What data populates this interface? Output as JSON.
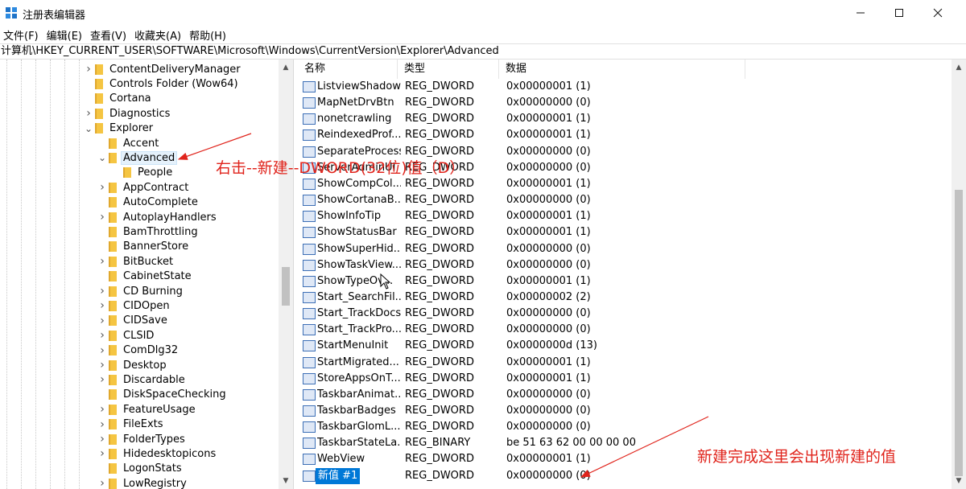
{
  "window": {
    "title": "注册表编辑器",
    "minimize": "—",
    "maximize": "☐",
    "close": "✕"
  },
  "menu": [
    "文件(F)",
    "编辑(E)",
    "查看(V)",
    "收藏夹(A)",
    "帮助(H)"
  ],
  "address": "计算机\\HKEY_CURRENT_USER\\SOFTWARE\\Microsoft\\Windows\\CurrentVersion\\Explorer\\Advanced",
  "tree": [
    {
      "label": "ContentDeliveryManager",
      "level": 1,
      "expander": "collapsed"
    },
    {
      "label": "Controls Folder (Wow64)",
      "level": 1,
      "expander": "none"
    },
    {
      "label": "Cortana",
      "level": 1,
      "expander": "none"
    },
    {
      "label": "Diagnostics",
      "level": 1,
      "expander": "collapsed"
    },
    {
      "label": "Explorer",
      "level": 1,
      "expander": "expanded"
    },
    {
      "label": "Accent",
      "level": 2,
      "expander": "none"
    },
    {
      "label": "Advanced",
      "level": 2,
      "expander": "expanded",
      "selected": true
    },
    {
      "label": "People",
      "level": 3,
      "expander": "none"
    },
    {
      "label": "AppContract",
      "level": 2,
      "expander": "collapsed"
    },
    {
      "label": "AutoComplete",
      "level": 2,
      "expander": "none"
    },
    {
      "label": "AutoplayHandlers",
      "level": 2,
      "expander": "collapsed"
    },
    {
      "label": "BamThrottling",
      "level": 2,
      "expander": "none"
    },
    {
      "label": "BannerStore",
      "level": 2,
      "expander": "none"
    },
    {
      "label": "BitBucket",
      "level": 2,
      "expander": "collapsed"
    },
    {
      "label": "CabinetState",
      "level": 2,
      "expander": "none"
    },
    {
      "label": "CD Burning",
      "level": 2,
      "expander": "collapsed"
    },
    {
      "label": "CIDOpen",
      "level": 2,
      "expander": "collapsed"
    },
    {
      "label": "CIDSave",
      "level": 2,
      "expander": "collapsed"
    },
    {
      "label": "CLSID",
      "level": 2,
      "expander": "collapsed"
    },
    {
      "label": "ComDlg32",
      "level": 2,
      "expander": "collapsed"
    },
    {
      "label": "Desktop",
      "level": 2,
      "expander": "collapsed"
    },
    {
      "label": "Discardable",
      "level": 2,
      "expander": "collapsed"
    },
    {
      "label": "DiskSpaceChecking",
      "level": 2,
      "expander": "none"
    },
    {
      "label": "FeatureUsage",
      "level": 2,
      "expander": "collapsed"
    },
    {
      "label": "FileExts",
      "level": 2,
      "expander": "collapsed"
    },
    {
      "label": "FolderTypes",
      "level": 2,
      "expander": "collapsed"
    },
    {
      "label": "Hidedesktopicons",
      "level": 2,
      "expander": "collapsed"
    },
    {
      "label": "LogonStats",
      "level": 2,
      "expander": "none"
    },
    {
      "label": "LowRegistry",
      "level": 2,
      "expander": "collapsed"
    }
  ],
  "columns": {
    "name": "名称",
    "type": "类型",
    "data": "数据"
  },
  "values": [
    {
      "name": "ListviewShadow",
      "type": "REG_DWORD",
      "data": "0x00000001 (1)"
    },
    {
      "name": "MapNetDrvBtn",
      "type": "REG_DWORD",
      "data": "0x00000000 (0)"
    },
    {
      "name": "nonetcrawling",
      "type": "REG_DWORD",
      "data": "0x00000001 (1)"
    },
    {
      "name": "ReindexedProf...",
      "type": "REG_DWORD",
      "data": "0x00000001 (1)"
    },
    {
      "name": "SeparateProcess",
      "type": "REG_DWORD",
      "data": "0x00000000 (0)"
    },
    {
      "name": "ServerAdminUI",
      "type": "REG_DWORD",
      "data": "0x00000000 (0)"
    },
    {
      "name": "ShowCompCol...",
      "type": "REG_DWORD",
      "data": "0x00000001 (1)"
    },
    {
      "name": "ShowCortanaB...",
      "type": "REG_DWORD",
      "data": "0x00000000 (0)"
    },
    {
      "name": "ShowInfoTip",
      "type": "REG_DWORD",
      "data": "0x00000001 (1)"
    },
    {
      "name": "ShowStatusBar",
      "type": "REG_DWORD",
      "data": "0x00000001 (1)"
    },
    {
      "name": "ShowSuperHid...",
      "type": "REG_DWORD",
      "data": "0x00000000 (0)"
    },
    {
      "name": "ShowTaskView...",
      "type": "REG_DWORD",
      "data": "0x00000000 (0)"
    },
    {
      "name": "ShowTypeOv...",
      "type": "REG_DWORD",
      "data": "0x00000001 (1)"
    },
    {
      "name": "Start_SearchFil...",
      "type": "REG_DWORD",
      "data": "0x00000002 (2)"
    },
    {
      "name": "Start_TrackDocs",
      "type": "REG_DWORD",
      "data": "0x00000000 (0)"
    },
    {
      "name": "Start_TrackPro...",
      "type": "REG_DWORD",
      "data": "0x00000000 (0)"
    },
    {
      "name": "StartMenuInit",
      "type": "REG_DWORD",
      "data": "0x0000000d (13)"
    },
    {
      "name": "StartMigrated...",
      "type": "REG_DWORD",
      "data": "0x00000001 (1)"
    },
    {
      "name": "StoreAppsOnT...",
      "type": "REG_DWORD",
      "data": "0x00000001 (1)"
    },
    {
      "name": "TaskbarAnimat...",
      "type": "REG_DWORD",
      "data": "0x00000000 (0)"
    },
    {
      "name": "TaskbarBadges",
      "type": "REG_DWORD",
      "data": "0x00000000 (0)"
    },
    {
      "name": "TaskbarGlomL...",
      "type": "REG_DWORD",
      "data": "0x00000000 (0)"
    },
    {
      "name": "TaskbarStateLa...",
      "type": "REG_BINARY",
      "data": "be 51 63 62 00 00 00 00"
    },
    {
      "name": "WebView",
      "type": "REG_DWORD",
      "data": "0x00000001 (1)"
    },
    {
      "name": "新值 #1",
      "type": "REG_DWORD",
      "data": "0x00000000 (0)",
      "new": true
    }
  ],
  "annotations": {
    "right_click_hint": "右击--新建--DWORD(32位)值（D）",
    "new_value_hint": "新建完成这里会出现新建的值"
  },
  "colors": {
    "selection": "#0078d7",
    "annotation": "#e0241c",
    "folder": "#f5c542"
  },
  "icons": {
    "app": "registry-editor-icon",
    "value": "reg-value-icon",
    "folder": "folder-icon"
  }
}
